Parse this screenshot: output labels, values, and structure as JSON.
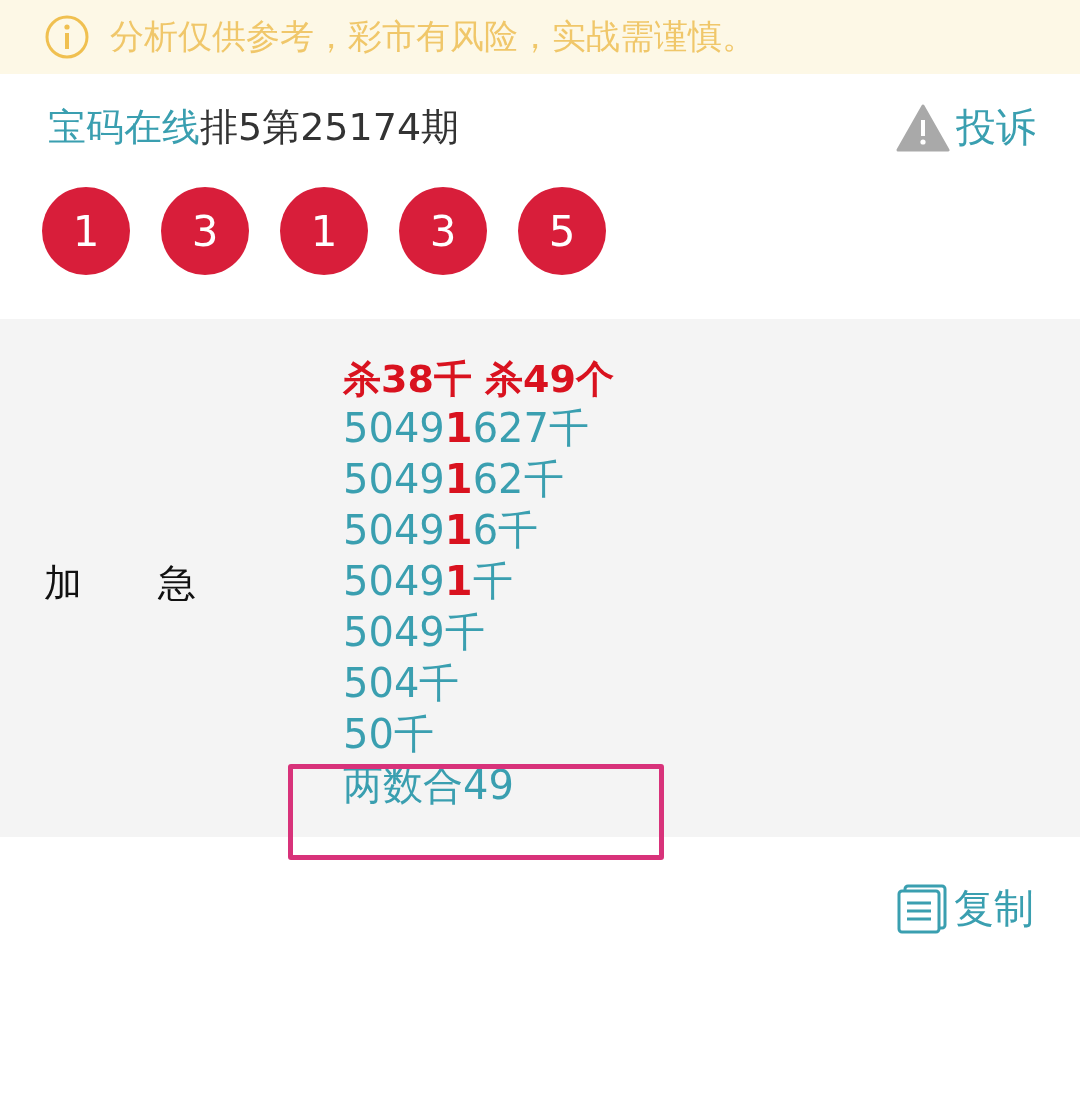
{
  "notice": {
    "text": "分析仅供参考，彩市有风险，实战需谨慎。"
  },
  "header": {
    "source": "宝码在线",
    "title": "排5第25174期",
    "complaint": "投诉"
  },
  "balls": [
    "1",
    "3",
    "1",
    "3",
    "5"
  ],
  "tip": {
    "label": "加　　急",
    "lines": [
      {
        "kind": "headline",
        "text": "杀38千 杀49个"
      },
      {
        "kind": "normal",
        "text": "5049**1**627千"
      },
      {
        "kind": "normal",
        "text": "5049**1**62千"
      },
      {
        "kind": "normal",
        "text": "5049**1**6千"
      },
      {
        "kind": "normal",
        "text": "5049**1**千"
      },
      {
        "kind": "normal",
        "text": "5049千"
      },
      {
        "kind": "normal",
        "text": "504千"
      },
      {
        "kind": "normal",
        "text": "50千"
      },
      {
        "kind": "normal",
        "text": "两数合49"
      }
    ]
  },
  "copy": "复制"
}
